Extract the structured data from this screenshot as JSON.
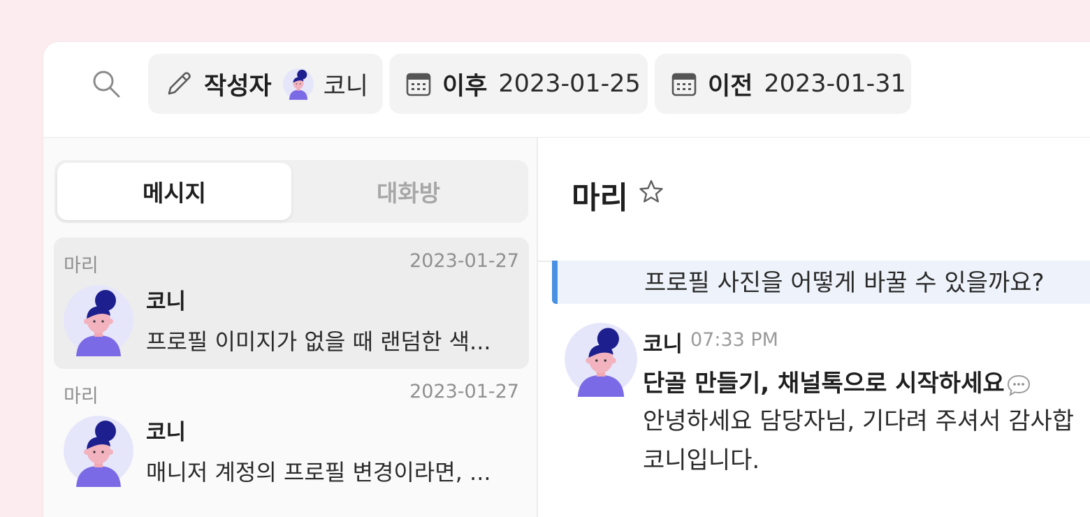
{
  "filters": {
    "author": {
      "label": "작성자",
      "value": "코니"
    },
    "after": {
      "label": "이후",
      "value": "2023-01-25"
    },
    "before": {
      "label": "이전",
      "value": "2023-01-31"
    }
  },
  "tabs": [
    {
      "label": "메시지",
      "active": true
    },
    {
      "label": "대화방",
      "active": false
    }
  ],
  "results": [
    {
      "room": "마리",
      "date": "2023-01-27",
      "author": "코니",
      "text": "프로필 이미지가 없을 때 랜덤한 색...",
      "selected": true
    },
    {
      "room": "마리",
      "date": "2023-01-27",
      "author": "코니",
      "text": "매니저 계정의 프로필 변경이라면, ...",
      "selected": false
    }
  ],
  "conversation": {
    "title": "마리",
    "quoted": "프로필 사진을 어떻게 바꿀 수 있을까요?",
    "message": {
      "author": "코니",
      "time": "07:33 PM",
      "title": "단골 만들기, 채널톡으로 시작하세요",
      "line1": "안녕하세요 담당자님, 기다려 주셔서 감사합",
      "line2": "코니입니다."
    }
  },
  "colors": {
    "background": "#fdecef",
    "accent": "#4a90e2",
    "quote_bg": "#eef3fb",
    "avatar_hair": "#1e1f8f",
    "avatar_body": "#7b6ae6"
  },
  "icons": [
    "search-icon",
    "pencil-icon",
    "calendar-icon",
    "star-icon",
    "speech-bubble-icon",
    "avatar"
  ]
}
